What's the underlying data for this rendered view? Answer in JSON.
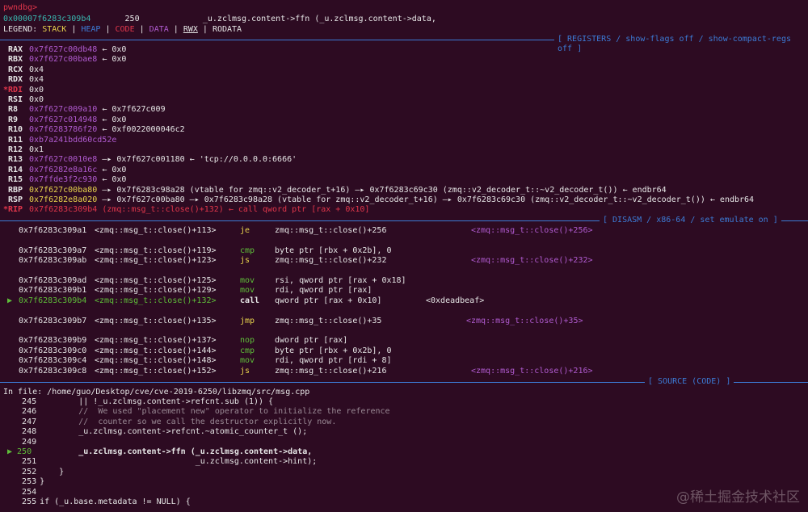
{
  "top": {
    "prompt": "pwndbg>",
    "addr": "0x00007f6283c309b4",
    "line_no": "250",
    "snippet": "_u.zclmsg.content->ffn (_u.zclmsg.content->data,"
  },
  "legend": {
    "prefix": "LEGEND:",
    "stack": "STACK",
    "heap": "HEAP",
    "code": "CODE",
    "data": "DATA",
    "rwx": "RWX",
    "rodata": "RODATA"
  },
  "registers_header": "[ REGISTERS / show-flags off / show-compact-regs off ]",
  "registers": [
    {
      "name": "RAX",
      "mark": "",
      "value": "0x7f627c00db48",
      "rest": "← 0x0"
    },
    {
      "name": "RBX",
      "mark": "",
      "value": "0x7f627c00bae8",
      "rest": "← 0x0"
    },
    {
      "name": "RCX",
      "mark": "",
      "value": "0x4",
      "rest": ""
    },
    {
      "name": "RDX",
      "mark": "",
      "value": "0x4",
      "rest": ""
    },
    {
      "name": "RDI",
      "mark": "*",
      "value": "0x0",
      "rest": ""
    },
    {
      "name": "RSI",
      "mark": "",
      "value": "0x0",
      "rest": ""
    },
    {
      "name": "R8",
      "mark": "",
      "value": "0x7f627c009a10",
      "rest": "← 0x7f627c009"
    },
    {
      "name": "R9",
      "mark": "",
      "value": "0x7f627c014948",
      "rest": "← 0x0"
    },
    {
      "name": "R10",
      "mark": "",
      "value": "0x7f6283786f20",
      "rest": "← 0xf0022000046c2"
    },
    {
      "name": "R11",
      "mark": "",
      "value": "0xb7a241bdd60cd52e",
      "rest": ""
    },
    {
      "name": "R12",
      "mark": "",
      "value": "0x1",
      "rest": ""
    },
    {
      "name": "R13",
      "mark": "",
      "value": "0x7f627c0010e8",
      "rest": "—▸ 0x7f627c001180 ← 'tcp://0.0.0.0:6666'"
    },
    {
      "name": "R14",
      "mark": "",
      "value": "0x7f6282e8a16c",
      "rest": "← 0x0"
    },
    {
      "name": "R15",
      "mark": "",
      "value": "0x7ffde3f2c930",
      "rest": "← 0x0"
    },
    {
      "name": "RBP",
      "mark": "",
      "value": "0x7f627c00ba80",
      "rest": "—▸ 0x7f6283c98a28 (vtable for zmq::v2_decoder_t+16) —▸ 0x7f6283c69c30 (zmq::v2_decoder_t::~v2_decoder_t()) ← endbr64"
    },
    {
      "name": "RSP",
      "mark": "",
      "value": "0x7f6282e8a020",
      "rest": "—▸ 0x7f627c00ba80 —▸ 0x7f6283c98a28 (vtable for zmq::v2_decoder_t+16) —▸ 0x7f6283c69c30 (zmq::v2_decoder_t::~v2_decoder_t()) ← endbr64"
    },
    {
      "name": "RIP",
      "mark": "*",
      "value": "0x7f6283c309b4",
      "rest": "(zmq::msg_t::close()+132) ← call qword ptr [rax + 0x10]"
    }
  ],
  "disasm_header": "[ DISASM / x86-64 / set emulate on ]",
  "disasm": [
    {
      "addr": "0x7f6283c309a1",
      "sym": "<zmq::msg_t::close()+113>",
      "mn": "je",
      "op": "zmq::msg_t::close()+256",
      "tgt": "<zmq::msg_t::close()+256>",
      "cur": false,
      "gap": false
    },
    {
      "addr": "0x7f6283c309a7",
      "sym": "<zmq::msg_t::close()+119>",
      "mn": "cmp",
      "op": "byte ptr [rbx + 0x2b], 0",
      "tgt": "",
      "cur": false,
      "gap": true
    },
    {
      "addr": "0x7f6283c309ab",
      "sym": "<zmq::msg_t::close()+123>",
      "mn": "js",
      "op": "zmq::msg_t::close()+232",
      "tgt": "<zmq::msg_t::close()+232>",
      "cur": false,
      "gap": false
    },
    {
      "addr": "0x7f6283c309ad",
      "sym": "<zmq::msg_t::close()+125>",
      "mn": "mov",
      "op": "rsi, qword ptr [rax + 0x18]",
      "tgt": "",
      "cur": false,
      "gap": true
    },
    {
      "addr": "0x7f6283c309b1",
      "sym": "<zmq::msg_t::close()+129>",
      "mn": "mov",
      "op": "rdi, qword ptr [rax]",
      "tgt": "",
      "cur": false,
      "gap": false
    },
    {
      "addr": "0x7f6283c309b4",
      "sym": "<zmq::msg_t::close()+132>",
      "mn": "call",
      "op": "qword ptr [rax + 0x10]",
      "tgt": "<0xdeadbeaf>",
      "cur": true,
      "gap": false
    },
    {
      "addr": "0x7f6283c309b7",
      "sym": "<zmq::msg_t::close()+135>",
      "mn": "jmp",
      "op": "zmq::msg_t::close()+35",
      "tgt": "<zmq::msg_t::close()+35>",
      "cur": false,
      "gap": true
    },
    {
      "addr": "0x7f6283c309b9",
      "sym": "<zmq::msg_t::close()+137>",
      "mn": "nop",
      "op": "dword ptr [rax]",
      "tgt": "",
      "cur": false,
      "gap": true
    },
    {
      "addr": "0x7f6283c309c0",
      "sym": "<zmq::msg_t::close()+144>",
      "mn": "cmp",
      "op": "byte ptr [rbx + 0x2b], 0",
      "tgt": "",
      "cur": false,
      "gap": false
    },
    {
      "addr": "0x7f6283c309c4",
      "sym": "<zmq::msg_t::close()+148>",
      "mn": "mov",
      "op": "rdi, qword ptr [rdi + 8]",
      "tgt": "",
      "cur": false,
      "gap": false
    },
    {
      "addr": "0x7f6283c309c8",
      "sym": "<zmq::msg_t::close()+152>",
      "mn": "js",
      "op": "zmq::msg_t::close()+216",
      "tgt": "<zmq::msg_t::close()+216>",
      "cur": false,
      "gap": false
    }
  ],
  "source_header": "[ SOURCE (CODE) ]",
  "source_file": "In file: /home/guo/Desktop/cve/cve-2019-6250/libzmq/src/msg.cpp",
  "source": [
    {
      "n": "245",
      "code": "            || !_u.zclmsg.content->refcnt.sub (1)) {",
      "cur": false
    },
    {
      "n": "246",
      "code": "            //  We used \"placement new\" operator to initialize the reference",
      "cur": false
    },
    {
      "n": "247",
      "code": "            //  counter so we call the destructor explicitly now.",
      "cur": false
    },
    {
      "n": "248",
      "code": "            _u.zclmsg.content->refcnt.~atomic_counter_t ();",
      "cur": false
    },
    {
      "n": "249",
      "code": "",
      "cur": false
    },
    {
      "n": "250",
      "code": "            _u.zclmsg.content->ffn (_u.zclmsg.content->data,",
      "cur": true
    },
    {
      "n": "251",
      "code": "                                    _u.zclmsg.content->hint);",
      "cur": false
    },
    {
      "n": "252",
      "code": "        }",
      "cur": false
    },
    {
      "n": "253",
      "code": "    }",
      "cur": false
    },
    {
      "n": "254",
      "code": "",
      "cur": false
    },
    {
      "n": "255",
      "code": "    if (_u.base.metadata != NULL) {",
      "cur": false
    }
  ],
  "watermark": "@稀土掘金技术社区"
}
